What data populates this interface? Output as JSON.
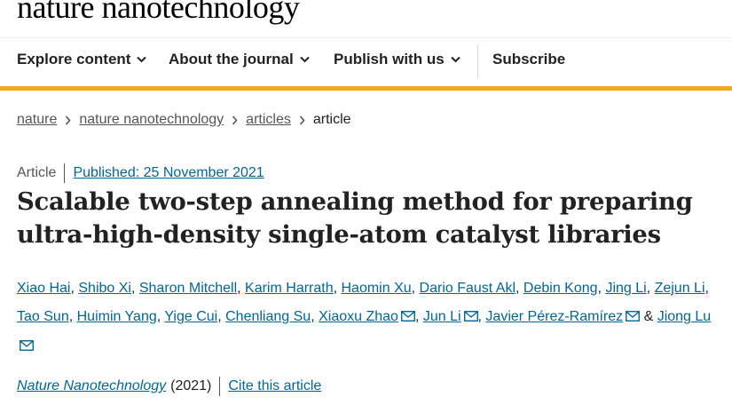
{
  "brand": {
    "name": "nature nanotechnology"
  },
  "nav": {
    "items": [
      {
        "label": "Explore content",
        "icon": "chevron-down-icon"
      },
      {
        "label": "About the journal",
        "icon": "chevron-down-icon"
      },
      {
        "label": "Publish with us",
        "icon": "chevron-down-icon"
      }
    ],
    "subscribe": "Subscribe",
    "accent_color": "#f5a623"
  },
  "breadcrumb": {
    "items": [
      "nature",
      "nature nanotechnology",
      "articles"
    ],
    "current": "article"
  },
  "article": {
    "type": "Article",
    "published": "Published: 25 November 2021",
    "title": "Scalable two-step annealing method for preparing ultra-high-density single-atom catalyst libraries",
    "authors": [
      "Xiao Hai",
      "Shibo Xi",
      "Sharon Mitchell",
      "Karim Harrath",
      "Haomin Xu",
      "Dario Faust Akl",
      "Debin Kong",
      "Jing Li",
      "Zejun Li",
      "Tao Sun",
      "Huimin Yang",
      "Yige Cui",
      "Chenliang Su",
      "Xiaoxu Zhao",
      "Jun Li",
      "Javier Pérez-Ramírez",
      "Jiong Lu"
    ],
    "ampersand": "&",
    "journal": "Nature Nanotechnology",
    "year": "(2021)",
    "cite_label": "Cite this article",
    "link_color": "#006699"
  }
}
